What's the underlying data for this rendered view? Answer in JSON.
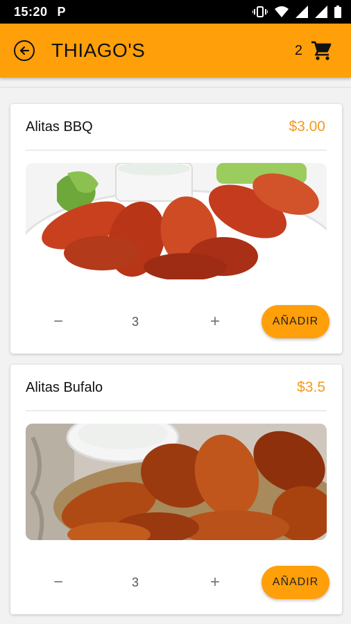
{
  "status_bar": {
    "time": "15:20",
    "app_icon": "P"
  },
  "appbar": {
    "title": "THIAGO'S",
    "cart_count": "2"
  },
  "products": [
    {
      "name": "Alitas BBQ",
      "price": "$3.00",
      "quantity": "3",
      "minus": "−",
      "plus": "+",
      "add_label": "AÑADIR"
    },
    {
      "name": "Alitas Bufalo",
      "price": "$3.5",
      "quantity": "3",
      "minus": "−",
      "plus": "+",
      "add_label": "AÑADIR"
    }
  ],
  "colors": {
    "primary": "#ff9f0a",
    "price": "#f39a1c"
  }
}
